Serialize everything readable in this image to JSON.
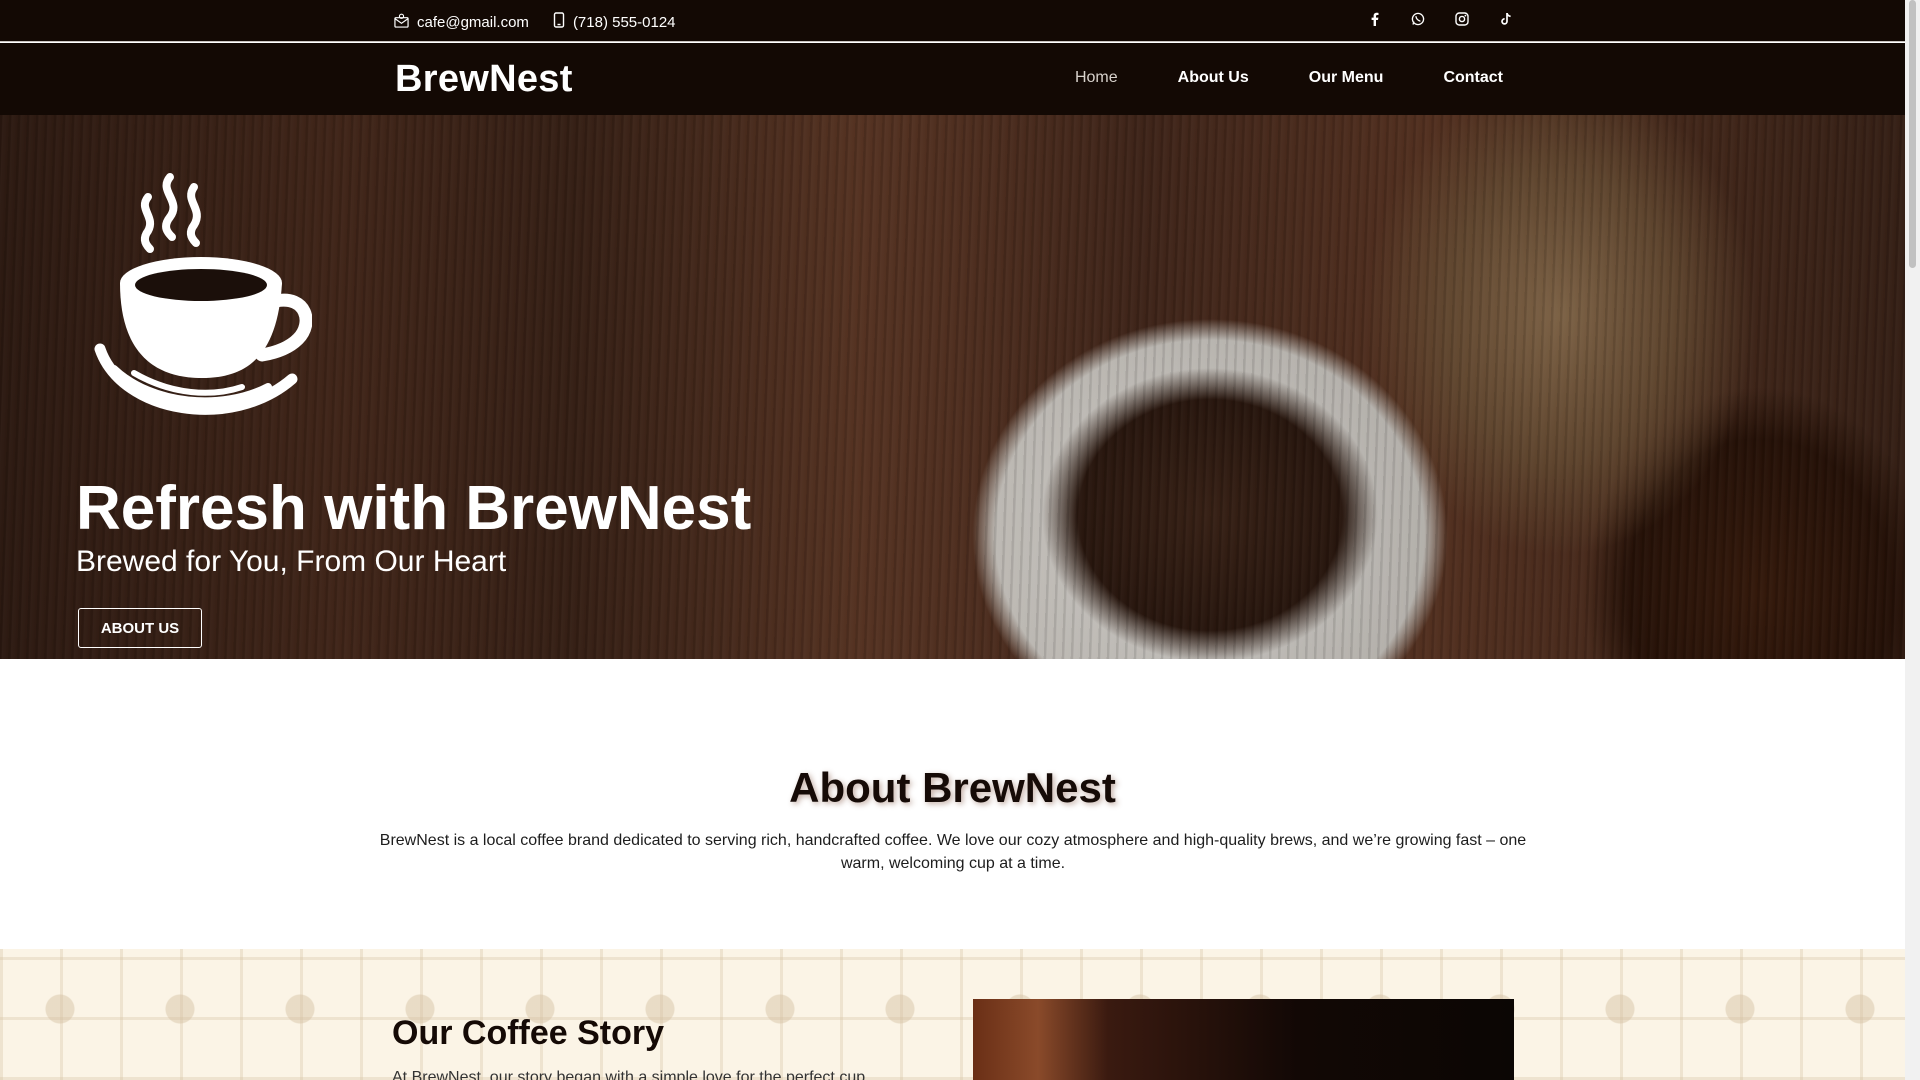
{
  "topbar": {
    "email": "cafe@gmail.com",
    "phone": "(718) 555-0124",
    "socials": [
      {
        "icon": "facebook-icon",
        "label": "f"
      },
      {
        "icon": "whatsapp-icon",
        "label": "whatsapp"
      },
      {
        "icon": "instagram-icon",
        "label": "instagram"
      },
      {
        "icon": "tiktok-icon",
        "label": "tiktok"
      }
    ]
  },
  "navbar": {
    "brand": "BrewNest",
    "items": [
      {
        "label": "Home",
        "active": true
      },
      {
        "label": "About Us",
        "active": false
      },
      {
        "label": "Our Menu",
        "active": false
      },
      {
        "label": "Contact",
        "active": false
      }
    ]
  },
  "hero": {
    "title": "Refresh with BrewNest",
    "subtitle": "Brewed for You, From Our Heart",
    "button": "ABOUT US"
  },
  "about": {
    "title": "About BrewNest",
    "text": "BrewNest is a local coffee brand dedicated to serving rich, handcrafted coffee. We love our cozy atmosphere and high-quality brews, and we’re growing fast – one warm, welcoming cup at a time."
  },
  "story": {
    "title": "Our Coffee Story",
    "text": "At BrewNest, our story began with a simple love for the perfect cup"
  },
  "colors": {
    "header_bg": "#130904",
    "accent_dark": "#160b07",
    "story_bg": "#fbf4e6"
  }
}
